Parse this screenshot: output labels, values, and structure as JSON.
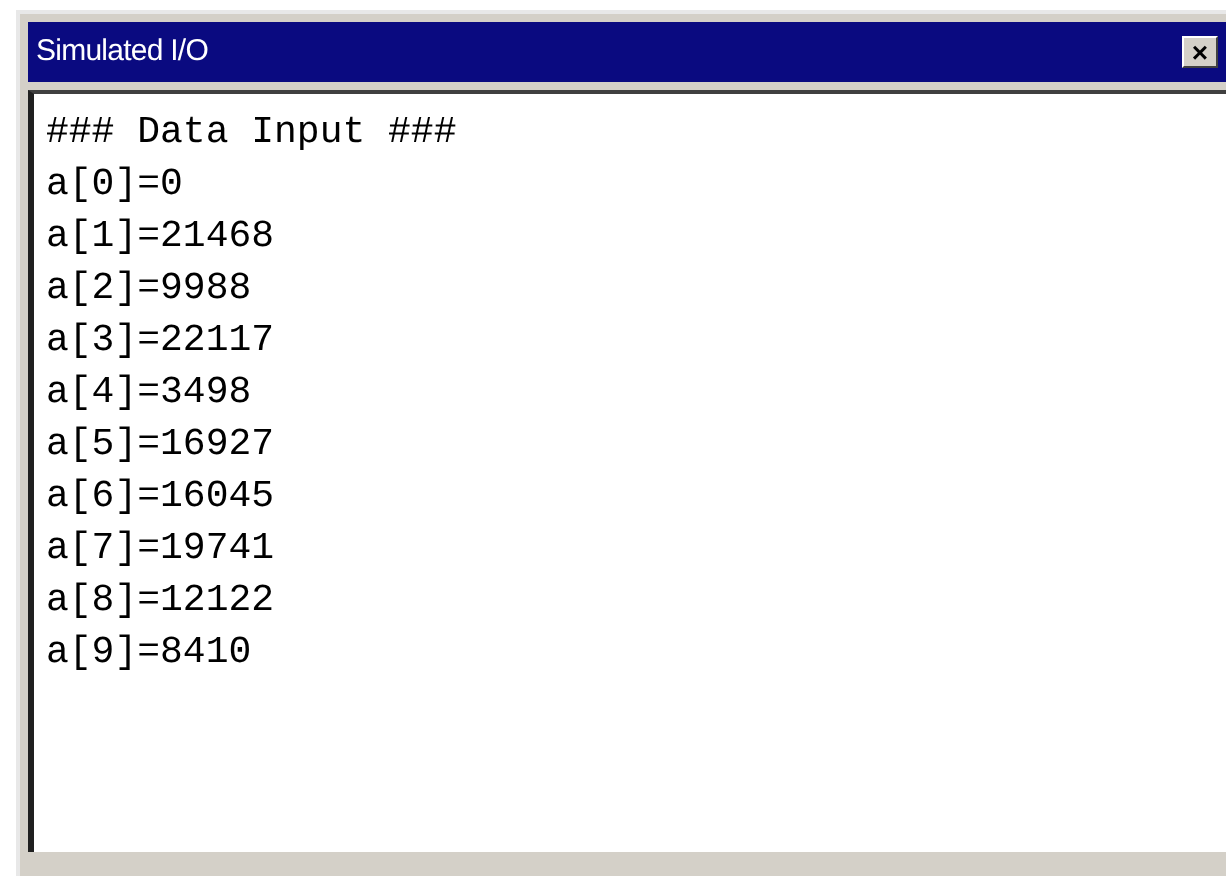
{
  "window": {
    "title": "Simulated I/O",
    "close_button": "×"
  },
  "output_lines": [
    "### Data Input ###",
    "a[0]=0",
    "a[1]=21468",
    "a[2]=9988",
    "a[3]=22117",
    "a[4]=3498",
    "a[5]=16927",
    "a[6]=16045",
    "a[7]=19741",
    "a[8]=12122",
    "a[9]=8410"
  ]
}
